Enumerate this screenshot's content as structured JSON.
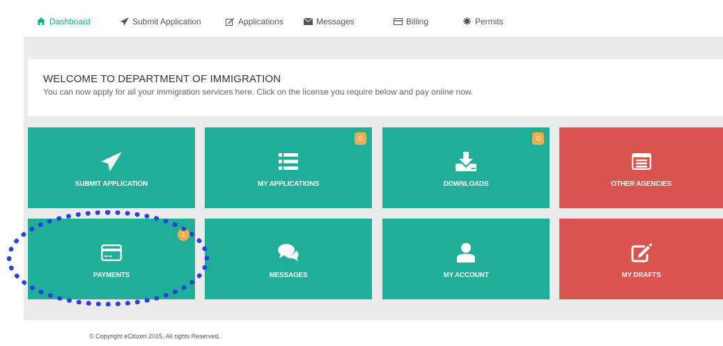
{
  "nav": {
    "items": [
      {
        "label": "Dashboard",
        "icon": "home-icon",
        "active": true
      },
      {
        "label": "Submit Application",
        "icon": "paper-plane-icon"
      },
      {
        "label": "Applications",
        "icon": "edit-icon"
      },
      {
        "label": "Messages",
        "icon": "envelope-icon"
      },
      {
        "label": "Billing",
        "icon": "credit-card-icon"
      },
      {
        "label": "Permits",
        "icon": "certificate-icon"
      }
    ]
  },
  "welcome": {
    "title": "WELCOME TO DEPARTMENT OF IMMIGRATION",
    "subtitle": "You can now apply for all your immigration services here. Click on the license you require below and pay online now."
  },
  "tiles": [
    {
      "label": "SUBMIT APPLICATION",
      "icon": "paper-plane-icon",
      "color": "#1fae98"
    },
    {
      "label": "MY APPLICATIONS",
      "icon": "list-icon",
      "color": "#1fae98",
      "badge": "0"
    },
    {
      "label": "DOWNLOADS",
      "icon": "download-icon",
      "color": "#1fae98",
      "badge": "0"
    },
    {
      "label": "OTHER AGENCIES",
      "icon": "window-list-icon",
      "color": "#d9534f"
    },
    {
      "label": "PAYMENTS",
      "icon": "credit-card-icon",
      "color": "#1fae98",
      "badge": "1"
    },
    {
      "label": "MESSAGES",
      "icon": "comments-icon",
      "color": "#1fae98"
    },
    {
      "label": "MY ACCOUNT",
      "icon": "user-icon",
      "color": "#1fae98"
    },
    {
      "label": "MY DRAFTS",
      "icon": "edit-icon",
      "color": "#d9534f"
    }
  ],
  "footer": {
    "text": "© Copyright eCitizen 2015. All rights Reserved."
  },
  "colors": {
    "accent": "#1fae98",
    "danger": "#d9534f",
    "badge": "#f0ad4e",
    "highlight": "#2b3fe0"
  }
}
